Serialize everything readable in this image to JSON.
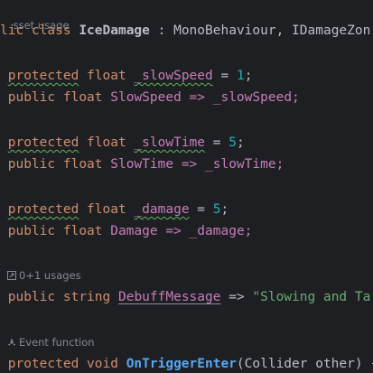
{
  "editor": {
    "top_hint": "sset usage",
    "class_decl": {
      "kw1": "lic",
      "kw2": "class",
      "name": "IceDamage",
      "rest": ": MonoBehaviour, IDamageZon"
    },
    "slow_speed": {
      "mod": "protected",
      "type": "float",
      "name": "_slowSpeed",
      "rest": " = ",
      "value": "1",
      "end": ";"
    },
    "slow_speed_prop": {
      "mod": "public",
      "type": "float",
      "name": "SlowSpeed",
      "rest": " => _slowSpeed;"
    },
    "slow_time": {
      "mod": "protected",
      "type": "float",
      "name": "_slowTime",
      "rest": " = ",
      "value": "5",
      "end": ";"
    },
    "slow_time_prop": {
      "mod": "public",
      "type": "float",
      "name": "SlowTime",
      "rest": " => _slowTime;"
    },
    "damage": {
      "mod": "protected",
      "type": "float",
      "name": "_damage",
      "rest": " = ",
      "value": "5",
      "end": ";"
    },
    "damage_prop": {
      "mod": "public",
      "type": "float",
      "name": "Damage",
      "rest": " => _damage;"
    },
    "usages_hint": "0+1 usages",
    "debuff": {
      "mod": "public",
      "type": "string",
      "name": "DebuffMessage",
      "arrow": " => ",
      "value": "\"Slowing and Ta"
    },
    "event_hint": "Event function",
    "trigger": {
      "mod": "protected",
      "type": "void",
      "name": "OnTriggerEnter",
      "params": "(Collider other) {"
    }
  },
  "colors": {
    "background": "#1e1f22",
    "keyword": "#cf8e6d",
    "field": "#c77dbb",
    "number": "#2aacb8",
    "string": "#6aab73",
    "method": "#56a8f5",
    "squiggle": "#5fb760"
  }
}
